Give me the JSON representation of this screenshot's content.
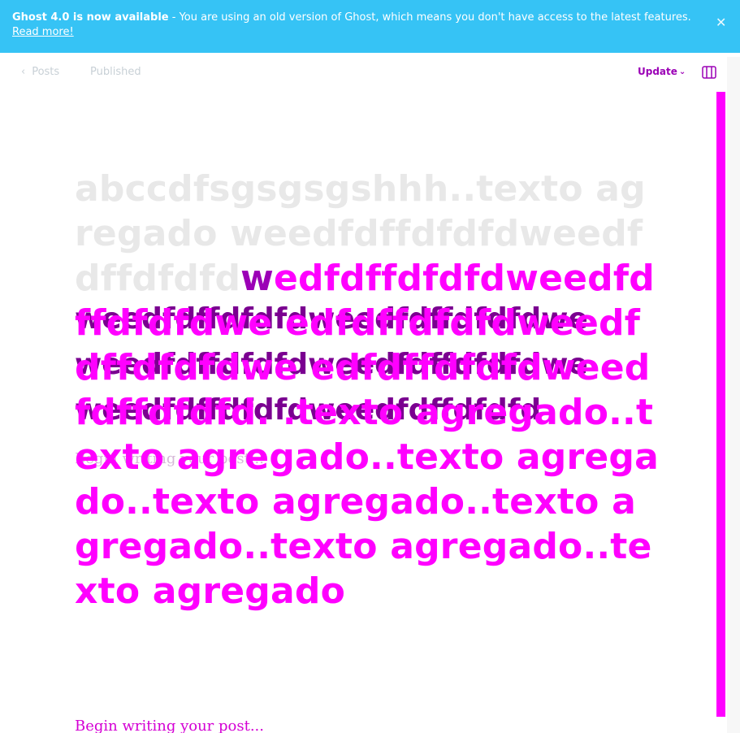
{
  "banner": {
    "strong": "Ghost 4.0 is now available",
    "message": " - You are using an old version of Ghost, which means you don't have access to the latest features.",
    "link": "Read more!",
    "close_icon": "close-icon"
  },
  "editor": {
    "back_label": "Posts",
    "status_label": "Published",
    "update_label": "Update",
    "settings_icon": "settings-icon"
  },
  "post": {
    "title_light": "abccdfsgsgsgshhh..texto agregado weedfdffdfdfdweedfdffdfdfd",
    "title_dark_1": "w",
    "title_ghost_line1": "weedfdffdfdfdweedfdffdfdfdwe",
    "title_ghost_line2": "weedfdffdfdfdweedfdffdfdfdwe",
    "title_ghost_line3": "weedfdffdfdfdweedfdffdfdfd",
    "title_magenta": "edfdffdfdfdweedfdffdfdfdwe edfdffdfdfdweedfdffdfdfdwe edfdffdfdfdweedfdffdfdfd. .texto agregado..texto agregado..texto agregado..texto agregado..texto agregado..texto agregado..texto agregado",
    "body_placeholder_ghost": "Begin writing your post...",
    "body_placeholder": "Begin writing your post..."
  },
  "colors": {
    "banner": "#36c3f5",
    "accent": "#ff00ff",
    "accent_dark": "#9b00b6"
  }
}
